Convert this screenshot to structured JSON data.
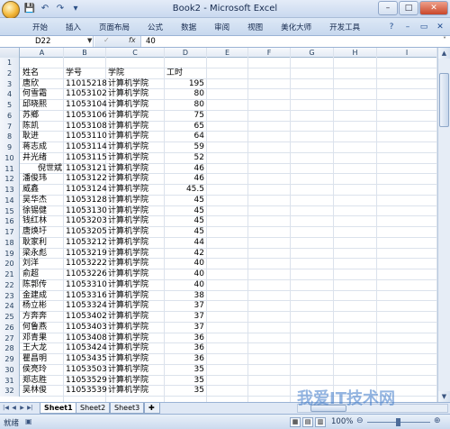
{
  "window": {
    "title": "Book2 - Microsoft Excel",
    "controls": {
      "minimize": "–",
      "maximize": "□",
      "close": "✕"
    }
  },
  "qat": [
    "💾",
    "↶",
    "↷",
    "▾"
  ],
  "ribbon": {
    "tabs": [
      "开始",
      "插入",
      "页面布局",
      "公式",
      "数据",
      "审阅",
      "视图",
      "美化大师",
      "开发工具"
    ],
    "help": "?",
    "min": "–",
    "restore": "▭",
    "close": "✕"
  },
  "formula_bar": {
    "name_box": "D22",
    "fx": "fx",
    "value": "40"
  },
  "columns": [
    "A",
    "B",
    "C",
    "D",
    "E",
    "F",
    "G",
    "H",
    "I"
  ],
  "rows": [
    {
      "n": "1",
      "a": "",
      "b": "",
      "c": "",
      "d": ""
    },
    {
      "n": "2",
      "a": "姓名",
      "b": "学号",
      "c": "学院",
      "d": "工时",
      "header": true
    },
    {
      "n": "3",
      "a": "唐欣",
      "b": "11015218",
      "c": "计算机学院",
      "d": "195"
    },
    {
      "n": "4",
      "a": "何雪霜",
      "b": "11053102",
      "c": "计算机学院",
      "d": "80"
    },
    {
      "n": "5",
      "a": "邱晓熙",
      "b": "11053104",
      "c": "计算机学院",
      "d": "80"
    },
    {
      "n": "6",
      "a": "苏鄉",
      "b": "11053106",
      "c": "计算机学院",
      "d": "75"
    },
    {
      "n": "7",
      "a": "陈凯",
      "b": "11053108",
      "c": "计算机学院",
      "d": "65"
    },
    {
      "n": "8",
      "a": "耿进",
      "b": "11053110",
      "c": "计算机学院",
      "d": "64"
    },
    {
      "n": "9",
      "a": "蒋志成",
      "b": "11053114",
      "c": "计算机学院",
      "d": "59"
    },
    {
      "n": "10",
      "a": "井光绪",
      "b": "11053115",
      "c": "计算机学院",
      "d": "52"
    },
    {
      "n": "11",
      "a": "倪世斌",
      "b": "11053121",
      "c": "计算机学院",
      "d": "46",
      "indent": true
    },
    {
      "n": "12",
      "a": "潘俊玮",
      "b": "11053122",
      "c": "计算机学院",
      "d": "46"
    },
    {
      "n": "13",
      "a": "威鑫",
      "b": "11053124",
      "c": "计算机学院",
      "d": "45.5"
    },
    {
      "n": "14",
      "a": "吴华杰",
      "b": "11053128",
      "c": "计算机学院",
      "d": "45"
    },
    {
      "n": "15",
      "a": "徐锡健",
      "b": "11053130",
      "c": "计算机学院",
      "d": "45"
    },
    {
      "n": "16",
      "a": "钱红林",
      "b": "11053203",
      "c": "计算机学院",
      "d": "45"
    },
    {
      "n": "17",
      "a": "唐焕圩",
      "b": "11053205",
      "c": "计算机学院",
      "d": "45"
    },
    {
      "n": "18",
      "a": "耿家利",
      "b": "11053212",
      "c": "计算机学院",
      "d": "44"
    },
    {
      "n": "19",
      "a": "梁永彪",
      "b": "11053219",
      "c": "计算机学院",
      "d": "42"
    },
    {
      "n": "20",
      "a": "刘洋",
      "b": "11053222",
      "c": "计算机学院",
      "d": "40"
    },
    {
      "n": "21",
      "a": "俞超",
      "b": "11053226",
      "c": "计算机学院",
      "d": "40"
    },
    {
      "n": "22",
      "a": "陈郭传",
      "b": "11053310",
      "c": "计算机学院",
      "d": "40"
    },
    {
      "n": "23",
      "a": "金建成",
      "b": "11053316",
      "c": "计算机学院",
      "d": "38"
    },
    {
      "n": "24",
      "a": "杨立彬",
      "b": "11053324",
      "c": "计算机学院",
      "d": "37"
    },
    {
      "n": "25",
      "a": "方奔奔",
      "b": "11053402",
      "c": "计算机学院",
      "d": "37"
    },
    {
      "n": "26",
      "a": "何鲁燕",
      "b": "11053403",
      "c": "计算机学院",
      "d": "37"
    },
    {
      "n": "27",
      "a": "邓青果",
      "b": "11053408",
      "c": "计算机学院",
      "d": "36"
    },
    {
      "n": "28",
      "a": "王大龙",
      "b": "11053424",
      "c": "计算机学院",
      "d": "36"
    },
    {
      "n": "29",
      "a": "瞿昌明",
      "b": "11053435",
      "c": "计算机学院",
      "d": "36"
    },
    {
      "n": "30",
      "a": "侯亮玲",
      "b": "11053503",
      "c": "计算机学院",
      "d": "35"
    },
    {
      "n": "31",
      "a": "郑志胜",
      "b": "11053529",
      "c": "计算机学院",
      "d": "35"
    },
    {
      "n": "32",
      "a": "吴林俊",
      "b": "11053539",
      "c": "计算机学院",
      "d": "35"
    }
  ],
  "sheets": [
    "Sheet1",
    "Sheet2",
    "Sheet3"
  ],
  "status": {
    "text": "就绪",
    "zoom": "100%"
  },
  "watermark": "我爱IT技术网"
}
